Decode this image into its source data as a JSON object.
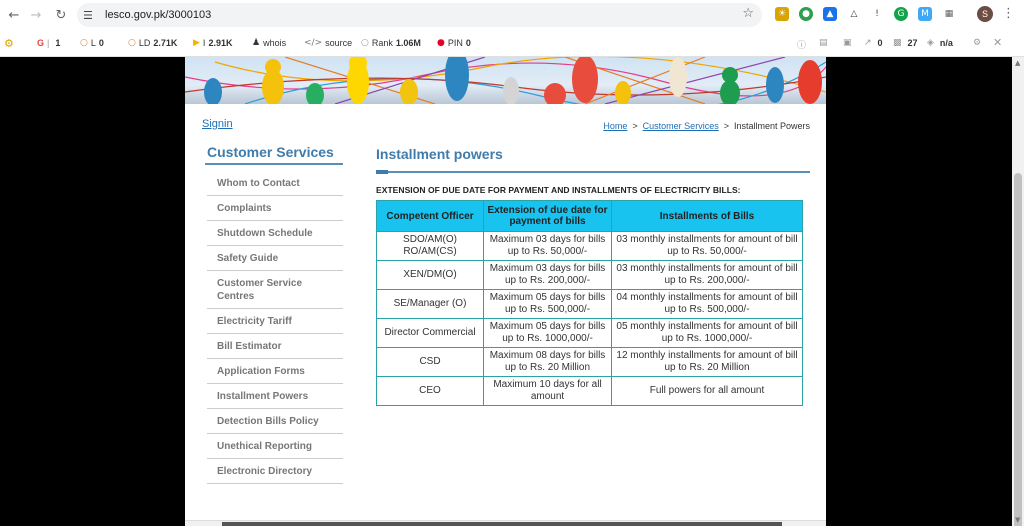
{
  "browser": {
    "url": "lesco.gov.pk/3000103",
    "profile_initial": "S"
  },
  "seobar": {
    "google_label": "G",
    "google_value": "1",
    "l_label": "L",
    "l_value": "0",
    "ld_label": "LD",
    "ld_value": "2.71K",
    "i_label": "I",
    "i_value": "2.91K",
    "whois": "whois",
    "source": "source",
    "rank_label": "Rank",
    "rank_value": "1.06M",
    "pin_label": "PIN",
    "pin_value": "0",
    "r1": "0",
    "r2": "27",
    "r3": "n/a"
  },
  "header": {
    "signin": "Signin",
    "breadcrumb": {
      "home": "Home",
      "sep1": ">",
      "customer_services": "Customer Services",
      "sep2": ">",
      "current": "Installment Powers"
    }
  },
  "sidebar": {
    "title": "Customer Services",
    "items": [
      {
        "label": "Whom to Contact"
      },
      {
        "label": "Complaints"
      },
      {
        "label": "Shutdown Schedule"
      },
      {
        "label": "Safety Guide"
      },
      {
        "label": "Customer Service Centres"
      },
      {
        "label": "Electricity Tariff"
      },
      {
        "label": "Bill Estimator"
      },
      {
        "label": "Application Forms"
      },
      {
        "label": "Installment Powers"
      },
      {
        "label": "Detection Bills Policy"
      },
      {
        "label": "Unethical Reporting"
      },
      {
        "label": "Electronic Directory"
      }
    ]
  },
  "main": {
    "title": "Installment powers",
    "subheading": "EXTENSION OF DUE DATE FOR PAYMENT AND INSTALLMENTS OF ELECTRICITY BILLS:",
    "table": {
      "headers": [
        "Competent Officer",
        "Extension of due date for payment of bills",
        "Installments of Bills"
      ],
      "rows": [
        [
          "SDO/AM(O) RO/AM(CS)",
          "Maximum 03 days for bills up to Rs. 50,000/-",
          "03 monthly installments for amount of bill up to Rs. 50,000/-"
        ],
        [
          "XEN/DM(O)",
          "Maximum 03 days for bills up to Rs. 200,000/-",
          "03 monthly installments for amount of bill up to Rs. 200,000/-"
        ],
        [
          "SE/Manager (O)",
          "Maximum 05 days for bills up to Rs. 500,000/-",
          "04 monthly installments for amount of bill up to Rs. 500,000/-"
        ],
        [
          "Director Commercial",
          "Maximum 05 days for bills up to Rs. 1000,000/-",
          "05 monthly installments for amount of bill up to Rs. 1000,000/-"
        ],
        [
          "CSD",
          "Maximum 08 days for bills up to Rs. 20 Million",
          "12 monthly installments for amount of bill up to Rs. 20 Million"
        ],
        [
          "CEO",
          "Maximum 10 days for all amount",
          "Full powers for all amount"
        ]
      ]
    }
  }
}
